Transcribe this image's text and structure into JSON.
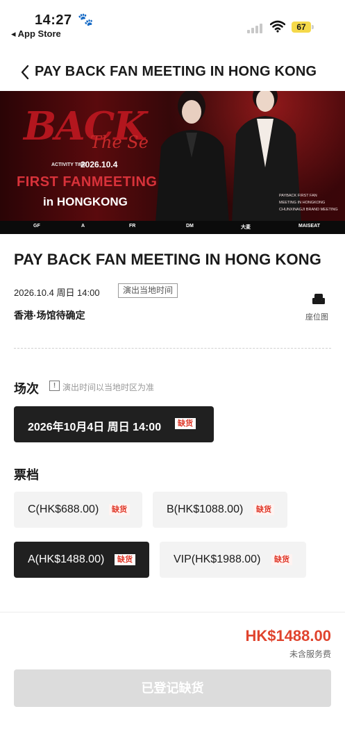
{
  "status_bar": {
    "time": "14:27",
    "back_app": "◂ App Store",
    "battery": "67",
    "icons": [
      "paw-icon",
      "signal-icon",
      "wifi-icon",
      "battery-icon"
    ]
  },
  "nav": {
    "title": "PAY BACK FAN MEETING IN HONG KONG",
    "back_icon": "chevron-left-icon"
  },
  "banner": {
    "headline": "BACK",
    "subheadline": "The Se",
    "activity_label": "ACTIVITY TIME",
    "activity_date": "2026.10.4",
    "first_fanmeeting": "FIRST FANMEETING",
    "city": "in HONGKONG",
    "meta_lines": [
      "PAYBACK FIRST FAN",
      "MEETING IN HONGKONG",
      "CHUNXINAGJI BRAND MEETING"
    ],
    "sponsors": [
      "GF",
      "A",
      "FR",
      "DM",
      "大麦",
      "MAISEAT"
    ]
  },
  "event": {
    "title": "PAY BACK FAN MEETING IN HONG KONG",
    "datetime": "2026.10.4 周日 14:00",
    "local_time_badge": "演出当地时间",
    "venue": "香港·场馆待确定",
    "seat_map_label": "座位图"
  },
  "session_section": {
    "heading": "场次",
    "tip_icon": "!",
    "tip": "演出时间以当地时区为准",
    "sessions": [
      {
        "label": "2026年10月4日 周日 14:00",
        "tag": "缺货",
        "selected": true
      }
    ]
  },
  "tier_section": {
    "heading": "票档",
    "tiers": [
      {
        "label": "C(HK$688.00)",
        "tag": "缺货",
        "selected": false
      },
      {
        "label": "B(HK$1088.00)",
        "tag": "缺货",
        "selected": false
      },
      {
        "label": "A(HK$1488.00)",
        "tag": "缺货",
        "selected": true
      },
      {
        "label": "VIP(HK$1988.00)",
        "tag": "缺货",
        "selected": false
      }
    ]
  },
  "footer": {
    "price": "HK$1488.00",
    "fee_note": "未含服务费",
    "button": "已登记缺货"
  },
  "colors": {
    "accent_red": "#e0442e",
    "selected_bg": "#202020",
    "disabled_button": "#dcdcdc",
    "battery_yellow": "#f5d94a"
  }
}
